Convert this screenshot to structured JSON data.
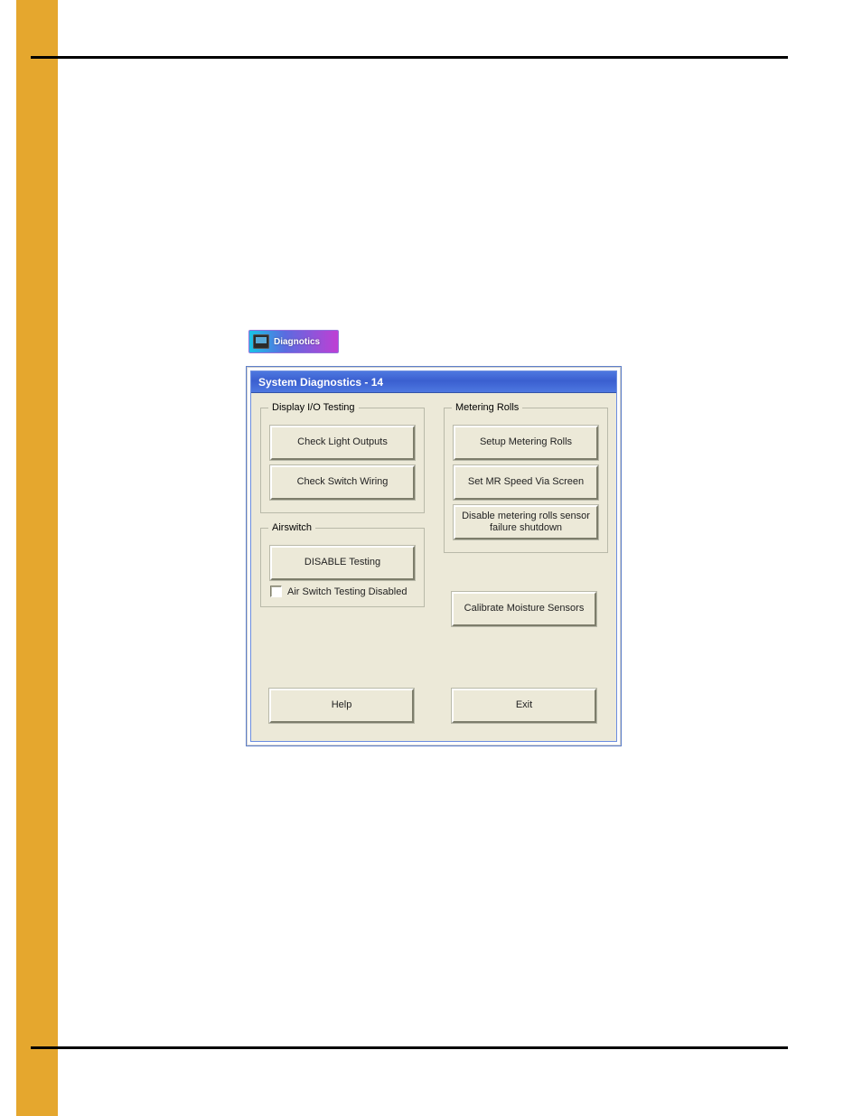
{
  "diagnostics_button": {
    "label": "Diagnotics"
  },
  "window": {
    "title": "System Diagnostics - 14",
    "groups": {
      "display_io": {
        "legend": "Display I/O Testing",
        "check_light_outputs": "Check Light Outputs",
        "check_switch_wiring": "Check Switch Wiring"
      },
      "airswitch": {
        "legend": "Airswitch",
        "disable_testing": "DISABLE Testing",
        "checkbox_label": "Air Switch Testing Disabled",
        "checkbox_checked": false
      },
      "metering_rolls": {
        "legend": "Metering Rolls",
        "setup": "Setup Metering Rolls",
        "set_speed": "Set MR Speed Via Screen",
        "disable_sensor": "Disable metering rolls sensor failure shutdown"
      }
    },
    "calibrate": "Calibrate Moisture Sensors",
    "help": "Help",
    "exit": "Exit"
  }
}
